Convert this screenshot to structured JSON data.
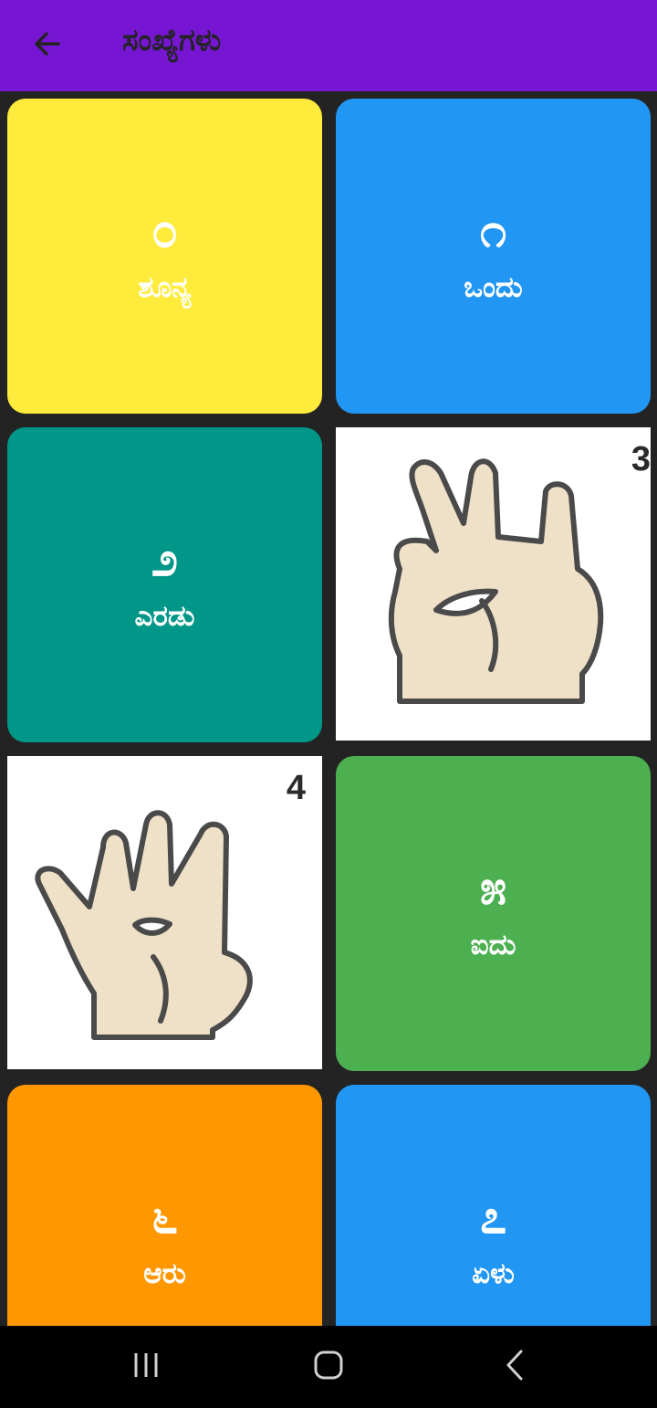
{
  "appbar": {
    "back_icon": "arrow-left-icon",
    "title": "ಸಂಖ್ಯೆಗಳು",
    "color": "#7616d3"
  },
  "tiles": [
    {
      "numeral": "೦",
      "word": "ಶೂನ್ಯ",
      "color": "#ffeb3b"
    },
    {
      "numeral": "೧",
      "word": "ಒಂದು",
      "color": "#2196f3"
    },
    {
      "numeral": "೨",
      "word": "ಎರಡು",
      "color": "#009688"
    },
    {
      "image": "hand-sign-three",
      "corner_label": "3"
    },
    {
      "image": "hand-sign-four",
      "corner_label": "4"
    },
    {
      "numeral": "೫",
      "word": "ಐದು",
      "color": "#4caf50"
    },
    {
      "numeral": "೬",
      "word": "ಆರು",
      "color": "#ff9800"
    },
    {
      "numeral": "೭",
      "word": "ಏಳು",
      "color": "#2196f3"
    }
  ],
  "navbar": {
    "recents_icon": "recent-apps-icon",
    "home_icon": "home-icon",
    "back_icon": "nav-back-icon"
  }
}
